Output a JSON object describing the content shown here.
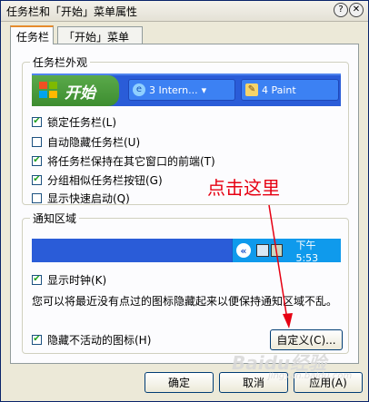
{
  "window": {
    "title": "任务栏和「开始」菜单属性",
    "help_icon": "question-icon",
    "close_icon": "close-icon"
  },
  "tabs": [
    {
      "label": "任务栏",
      "active": true
    },
    {
      "label": "「开始」菜单",
      "active": false
    }
  ],
  "appearance": {
    "title": "任务栏外观",
    "preview": {
      "start_label": "开始",
      "task1": "3 Intern...",
      "task1_arrow": "▾",
      "task2": "4 Paint"
    },
    "options": [
      {
        "label": "锁定任务栏(L)",
        "checked": true
      },
      {
        "label": "自动隐藏任务栏(U)",
        "checked": false
      },
      {
        "label": "将任务栏保持在其它窗口的前端(T)",
        "checked": true
      },
      {
        "label": "分组相似任务栏按钮(G)",
        "checked": true
      },
      {
        "label": "显示快速启动(Q)",
        "checked": false
      }
    ]
  },
  "notification": {
    "title": "通知区域",
    "tray": {
      "chevron": "«",
      "clock": "下午 5:53"
    },
    "show_clock": {
      "label": "显示时钟(K)",
      "checked": true
    },
    "info": "您可以将最近没有点过的图标隐藏起来以便保持通知区域不乱。",
    "hide_inactive": {
      "label": "隐藏不活动的图标(H)",
      "checked": true
    },
    "customize_button": "自定义(C)..."
  },
  "buttons": {
    "ok": "确定",
    "cancel": "取消",
    "apply": "应用(A)"
  },
  "annotation": {
    "text": "点击这里",
    "color": "#e60012"
  },
  "watermark": {
    "text": "Baidu经验",
    "sub": "jingyan.baidu.com"
  },
  "colors": {
    "taskbar": "#2a5cd8",
    "start": "#3d8d30",
    "tray": "#0f9aec",
    "check": "#21a121"
  }
}
